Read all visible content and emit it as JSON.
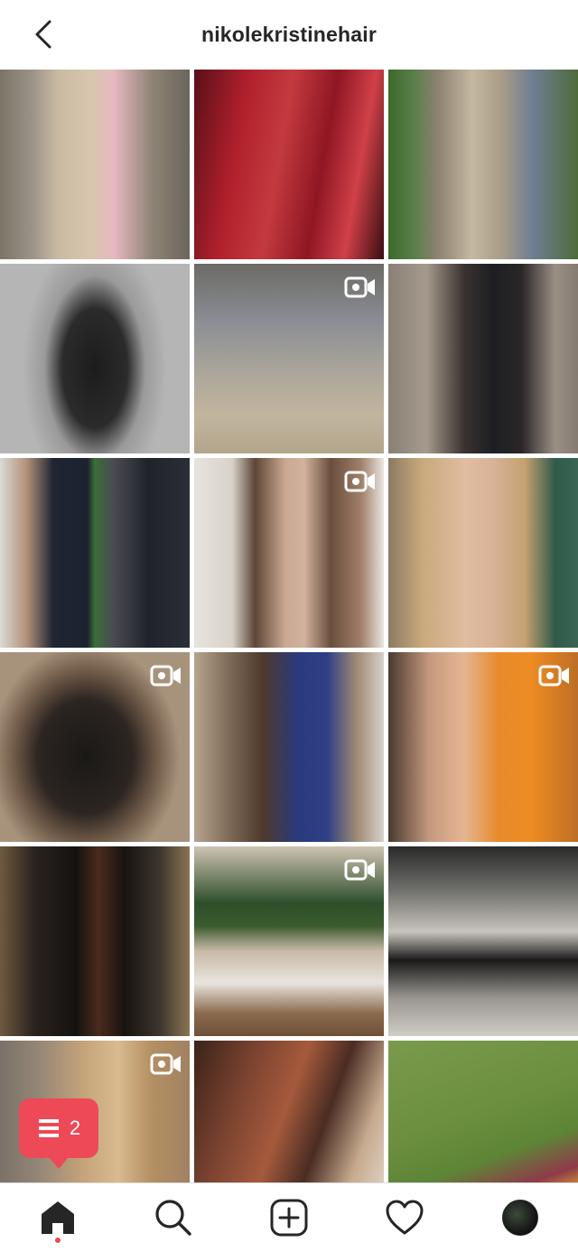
{
  "header": {
    "title": "nikolekristinehair",
    "back_icon": "chevron-left-icon"
  },
  "notification": {
    "icon": "activity-feed-icon",
    "count": "2",
    "color": "#ed4956"
  },
  "tabbar": {
    "items": [
      "home-icon",
      "search-icon",
      "new-post-icon",
      "heart-icon",
      "profile-avatar"
    ],
    "active": "home-icon"
  },
  "grid": {
    "posts": [
      {
        "subject": "long blonde hair, pink top",
        "video": false
      },
      {
        "subject": "red wavy hair",
        "video": false
      },
      {
        "subject": "blonde balayage waves",
        "video": false
      },
      {
        "subject": "woman in black dress",
        "video": false
      },
      {
        "subject": "ash blonde waves",
        "video": true
      },
      {
        "subject": "woman in Rolling Stones shirt",
        "video": false
      },
      {
        "subject": "before and after with masks",
        "video": false
      },
      {
        "subject": "woman with brown hair",
        "video": true
      },
      {
        "subject": "blonde woman selfie",
        "video": false
      },
      {
        "subject": "dark brown hair back view",
        "video": true
      },
      {
        "subject": "woman with black face mask",
        "video": false
      },
      {
        "subject": "woman in orange shirt",
        "video": true
      },
      {
        "subject": "long dark hair in salon",
        "video": false
      },
      {
        "subject": "girl watching tv",
        "video": true
      },
      {
        "subject": "two stylists in salon",
        "video": false
      },
      {
        "subject": "blonde balayage side view",
        "video": true
      },
      {
        "subject": "auburn waves with leopard mask",
        "video": false
      },
      {
        "subject": "woman on grass with flowers",
        "video": false
      },
      {
        "subject": "partial post",
        "video": false
      },
      {
        "subject": "partial post",
        "video": false
      },
      {
        "subject": "partial post",
        "video": false
      }
    ]
  }
}
